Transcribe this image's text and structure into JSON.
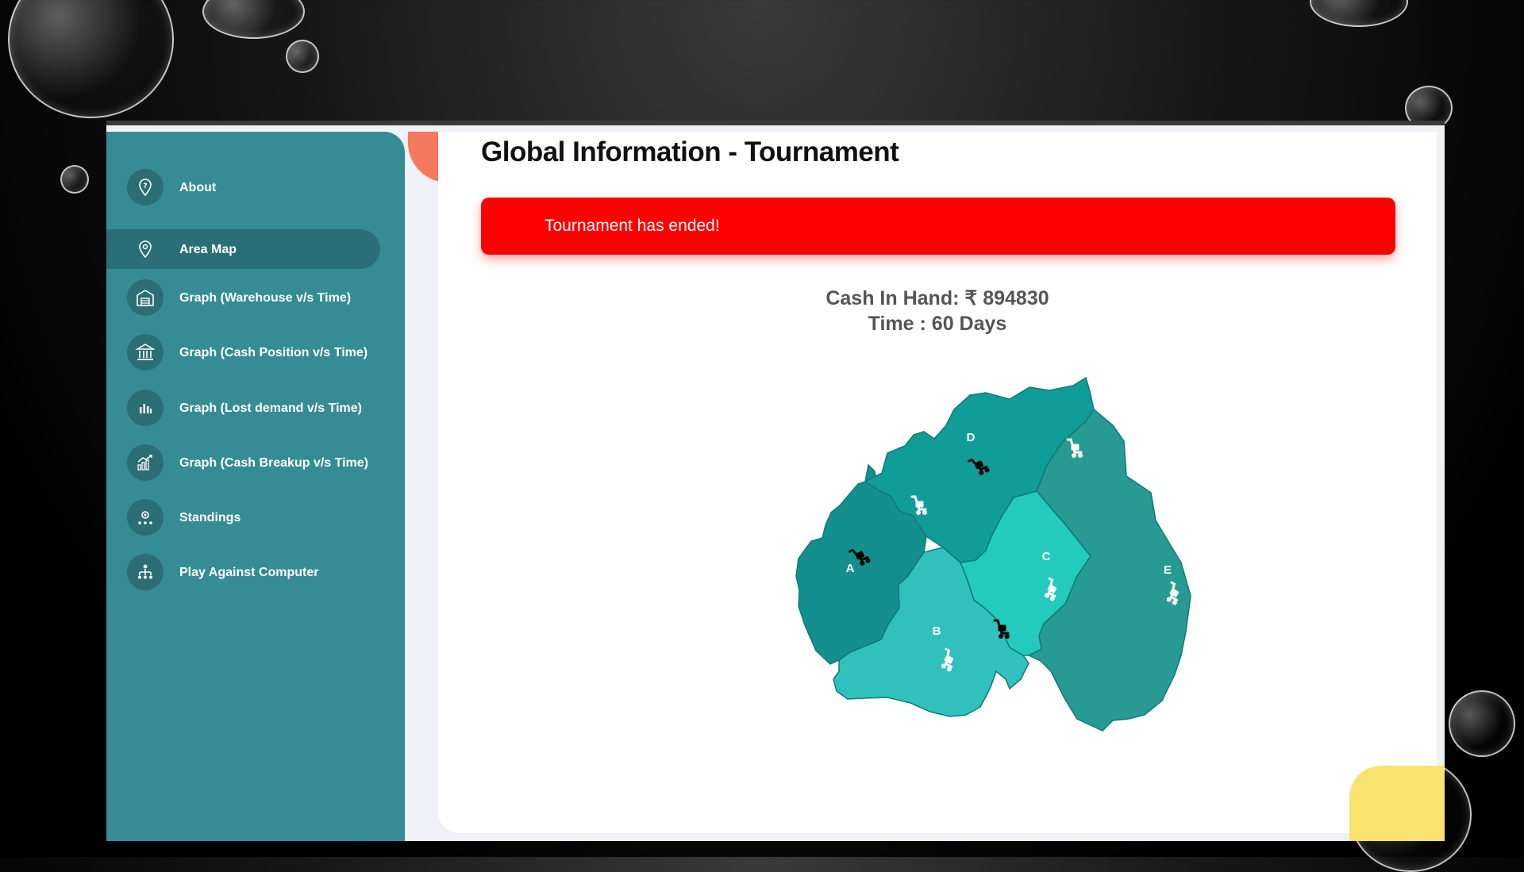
{
  "sidebar": {
    "items": [
      {
        "label": "About",
        "icon": "question-pin-icon",
        "active": false
      },
      {
        "label": "Area Map",
        "icon": "location-pin-icon",
        "active": true
      },
      {
        "label": "Graph (Warehouse v/s Time)",
        "icon": "warehouse-icon",
        "active": false
      },
      {
        "label": "Graph (Cash Position v/s Time)",
        "icon": "bank-icon",
        "active": false
      },
      {
        "label": "Graph (Lost demand v/s Time)",
        "icon": "bar-chart-icon",
        "active": false
      },
      {
        "label": "Graph (Cash Breakup v/s Time)",
        "icon": "growth-chart-icon",
        "active": false
      },
      {
        "label": "Standings",
        "icon": "podium-icon",
        "active": false
      },
      {
        "label": "Play Against Computer",
        "icon": "network-icon",
        "active": false
      }
    ]
  },
  "main": {
    "title": "Global Information - Tournament",
    "alert": "Tournament has ended!",
    "cash_line": "Cash In Hand: ₹ 894830",
    "time_line": "Time : 60 Days"
  },
  "map": {
    "regions": [
      {
        "id": "A",
        "label": "A",
        "color": "#138f8e"
      },
      {
        "id": "B",
        "label": "B",
        "color": "#31c1bd"
      },
      {
        "id": "C",
        "label": "C",
        "color": "#22cbbb"
      },
      {
        "id": "D",
        "label": "D",
        "color": "#109d97"
      },
      {
        "id": "E",
        "label": "E",
        "color": "#289a94"
      }
    ]
  },
  "colors": {
    "sidebar": "#368c95",
    "sidebar_active": "#2a6e77",
    "alert": "#ff0000"
  }
}
